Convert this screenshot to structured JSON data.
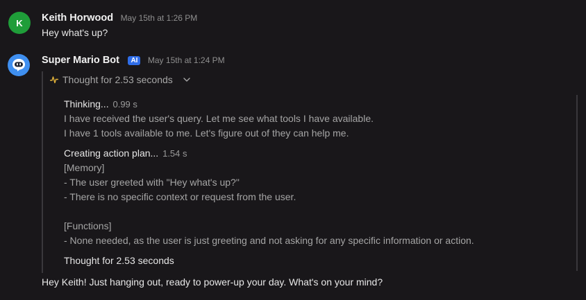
{
  "messages": {
    "user": {
      "avatar_letter": "K",
      "name": "Keith Horwood",
      "time": "May 15th at 1:26 PM",
      "text": "Hey what's up?"
    },
    "bot": {
      "name": "Super Mario Bot",
      "badge": "AI",
      "time": "May 15th at 1:24 PM",
      "thought_header": "Thought for 2.53 seconds",
      "thinking": {
        "title": "Thinking...",
        "duration": "0.99 s",
        "lines": [
          "I have received the user's query. Let me see what tools I have available.",
          "I have 1 tools available to me. Let's figure out of they can help me."
        ]
      },
      "plan": {
        "title": "Creating action plan...",
        "duration": "1.54 s",
        "lines": [
          "[Memory]",
          "- The user greeted with \"Hey what's up?\"",
          "- There is no specific context or request from the user.",
          "",
          "[Functions]",
          "- None needed, as the user is just greeting and not asking for any specific information or action."
        ]
      },
      "thought_footer": "Thought for 2.53 seconds",
      "reply": "Hey Keith! Just hanging out, ready to power-up your day. What's on your mind?"
    }
  },
  "colors": {
    "background": "#19171a",
    "user_avatar": "#1f9d39",
    "bot_avatar": "#3f8ff0",
    "ai_badge": "#2f6de8",
    "pulse_icon": "#e0b13a"
  }
}
